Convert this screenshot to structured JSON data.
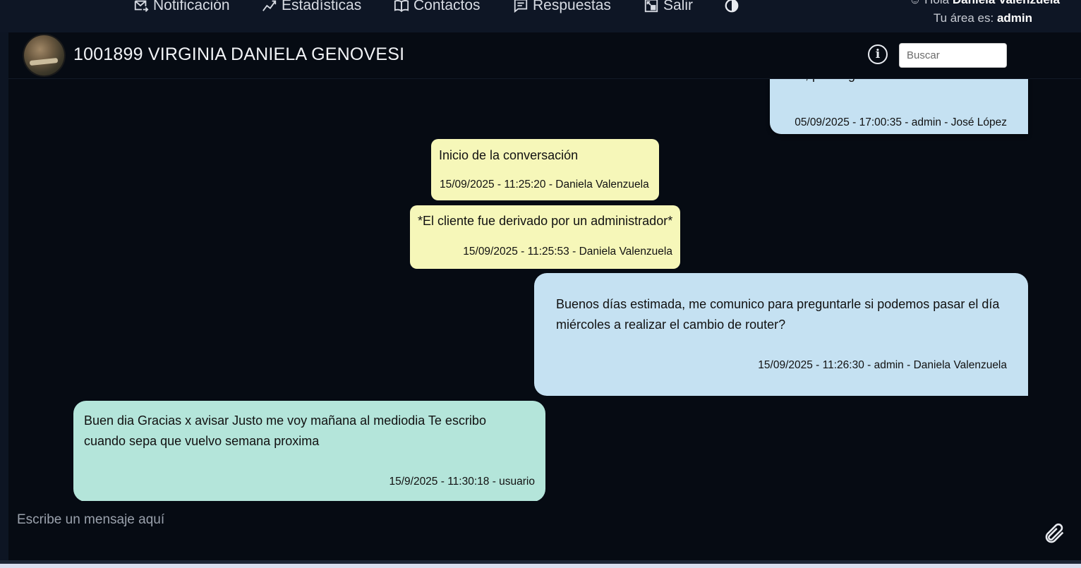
{
  "nav": {
    "items": [
      {
        "label": "Notificación",
        "icon": "mail-send-icon"
      },
      {
        "label": "Estadísticas",
        "icon": "trend-chart-icon"
      },
      {
        "label": "Contactos",
        "icon": "book-icon"
      },
      {
        "label": "Respuestas",
        "icon": "message-list-icon"
      },
      {
        "label": "Salir",
        "icon": "exit-icon"
      }
    ],
    "theme_toggle_icon": "contrast-icon",
    "greeting_prefix": "Hola",
    "user_name": "Daniela Valenzuela",
    "area_label": "Tu área es:",
    "area_value": "admin"
  },
  "chat": {
    "contact_title": "1001899 VIRGINIA DANIELA GENOVESI",
    "search_placeholder": "Buscar",
    "messages": [
      {
        "text": "... , por ... g...",
        "meta": "05/09/2025 - 17:00:35 - admin - José López",
        "kind": "agent"
      },
      {
        "text": "Inicio de la conversación",
        "meta": "15/09/2025 - 11:25:20 - Daniela Valenzuela",
        "kind": "system"
      },
      {
        "text": "*El cliente fue derivado por un administrador*",
        "meta": "15/09/2025 - 11:25:53 - Daniela Valenzuela",
        "kind": "system"
      },
      {
        "text": "Buenos días estimada, me comunico para preguntarle si podemos pasar el día miércoles a realizar el cambio de router?",
        "meta": "15/09/2025 - 11:26:30 - admin - Daniela Valenzuela",
        "kind": "agent"
      },
      {
        "text": "Buen dia Gracias x avisar Justo me voy mañana al mediodia Te escribo cuando sepa que vuelvo semana proxima",
        "meta": "15/9/2025 - 11:30:18 - usuario",
        "kind": "customer"
      }
    ],
    "composer_placeholder": "Escribe un mensaje aquí",
    "colors": {
      "agent_bubble": "#c5e1f2",
      "system_bubble": "#f6f7b9",
      "customer_bubble": "#b4e5da",
      "background": "#060b13"
    }
  }
}
